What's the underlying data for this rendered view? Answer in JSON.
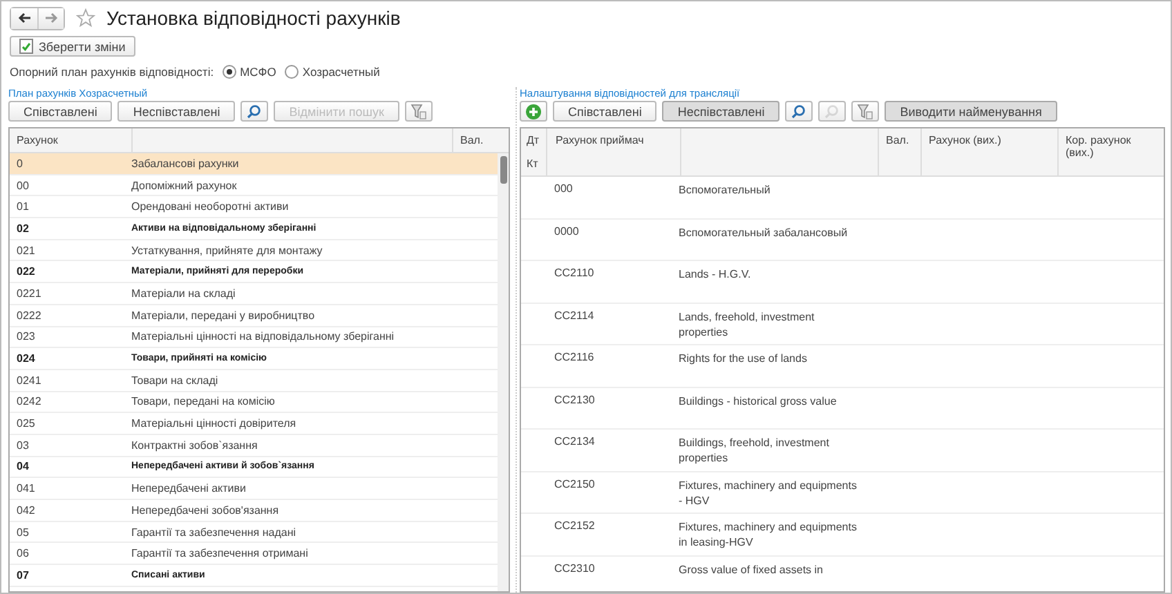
{
  "window": {
    "title": "Установка відповідності рахунків"
  },
  "save_button": {
    "label": "Зберегти зміни"
  },
  "reference_plan": {
    "label": "Опорний план рахунків відповідності:",
    "options": [
      {
        "label": "МСФО",
        "selected": true
      },
      {
        "label": "Хозрасчетный",
        "selected": false
      }
    ]
  },
  "left_panel": {
    "title": "План рахунків Хозрасчетный",
    "toolbar": [
      {
        "kind": "text",
        "label": "Співставлені",
        "pressed": false,
        "disabled": false
      },
      {
        "kind": "text",
        "label": "Неспівставлені",
        "pressed": false,
        "disabled": false
      },
      {
        "kind": "search",
        "pressed": false,
        "disabled": false
      },
      {
        "kind": "text",
        "label": "Відмінити пошук",
        "pressed": false,
        "disabled": true
      },
      {
        "kind": "filter",
        "pressed": false,
        "disabled": false
      }
    ],
    "columns": [
      "Рахунок",
      "Вал."
    ],
    "rows": [
      {
        "code": "0",
        "name": "Забалансові рахунки",
        "bold": false,
        "selected": true
      },
      {
        "code": "00",
        "name": "Допоміжний рахунок",
        "bold": false,
        "selected": false
      },
      {
        "code": "01",
        "name": "Орендовані необоротні активи",
        "bold": false,
        "selected": false
      },
      {
        "code": "02",
        "name": "Активи на відповідальному зберіганні",
        "bold": true,
        "selected": false
      },
      {
        "code": "021",
        "name": "Устаткування, прийняте для монтажу",
        "bold": false,
        "selected": false
      },
      {
        "code": "022",
        "name": "Матеріали, прийняті для переробки",
        "bold": true,
        "selected": false
      },
      {
        "code": "0221",
        "name": "Матеріали на складі",
        "bold": false,
        "selected": false
      },
      {
        "code": "0222",
        "name": "Матеріали, передані у виробництво",
        "bold": false,
        "selected": false
      },
      {
        "code": "023",
        "name": "Матеріальні цінності на відповідальному зберіганні",
        "bold": false,
        "selected": false
      },
      {
        "code": "024",
        "name": "Товари, прийняті на комісію",
        "bold": true,
        "selected": false
      },
      {
        "code": "0241",
        "name": "Товари на складі",
        "bold": false,
        "selected": false
      },
      {
        "code": "0242",
        "name": "Товари, передані на комісію",
        "bold": false,
        "selected": false
      },
      {
        "code": "025",
        "name": "Матеріальні цінності довірителя",
        "bold": false,
        "selected": false
      },
      {
        "code": "03",
        "name": "Контрактні зобов`язання",
        "bold": false,
        "selected": false
      },
      {
        "code": "04",
        "name": "Непередбачені активи й зобов`язання",
        "bold": true,
        "selected": false
      },
      {
        "code": "041",
        "name": "Непередбачені активи",
        "bold": false,
        "selected": false
      },
      {
        "code": "042",
        "name": "Непередбачені  зобов'язання",
        "bold": false,
        "selected": false
      },
      {
        "code": "05",
        "name": "Гарантії та забезпечення надані",
        "bold": false,
        "selected": false
      },
      {
        "code": "06",
        "name": "Гарантії та забезпечення отримані",
        "bold": false,
        "selected": false
      },
      {
        "code": "07",
        "name": "Списані активи",
        "bold": true,
        "selected": false
      }
    ]
  },
  "right_panel": {
    "title": "Налаштування відповідностей для трансляції",
    "toolbar": [
      {
        "kind": "add",
        "pressed": false,
        "disabled": false
      },
      {
        "kind": "text",
        "label": "Співставлені",
        "pressed": false,
        "disabled": false
      },
      {
        "kind": "text",
        "label": "Неспівставлені",
        "pressed": true,
        "disabled": false
      },
      {
        "kind": "search",
        "pressed": false,
        "disabled": false
      },
      {
        "kind": "search",
        "pressed": false,
        "disabled": true
      },
      {
        "kind": "filter",
        "pressed": false,
        "disabled": false
      },
      {
        "kind": "text",
        "label": "Виводити найменування",
        "pressed": true,
        "disabled": false
      }
    ],
    "columns": {
      "dt": "Дт",
      "kt": "Кт",
      "account": "Рахунок приймач",
      "currency": "Вал.",
      "account_out": "Рахунок (вих.)",
      "corr_account_out": "Кор. рахунок (вих.)"
    },
    "rows": [
      {
        "code": "000",
        "name": "Вспомогательный"
      },
      {
        "code": "0000",
        "name": "Вспомогательный забалансовый"
      },
      {
        "code": "CC2110",
        "name": "Lands - H.G.V."
      },
      {
        "code": "CC2114",
        "name": "Lands, freehold, investment properties"
      },
      {
        "code": "CC2116",
        "name": "Rights for the use of lands"
      },
      {
        "code": "CC2130",
        "name": "Buildings - historical gross value"
      },
      {
        "code": "CC2134",
        "name": "Buildings, freehold, investment properties"
      },
      {
        "code": "CC2150",
        "name": "Fixtures, machinery and equipments - HGV"
      },
      {
        "code": "CC2152",
        "name": "Fixtures, machinery and equipments in leasing-HGV"
      },
      {
        "code": "CC2310",
        "name": "Gross value of fixed assets in"
      }
    ]
  }
}
